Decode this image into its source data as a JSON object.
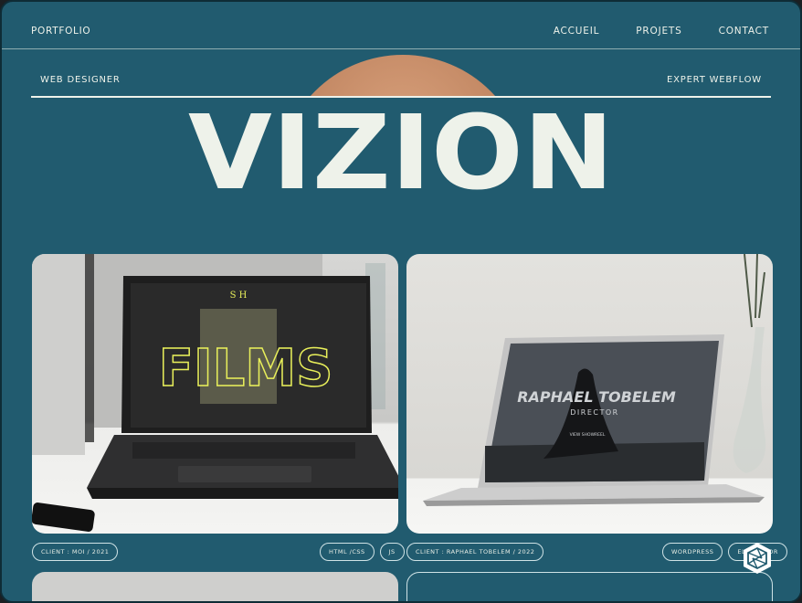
{
  "nav": {
    "brand": "PORTFOLIO",
    "links": [
      "ACCUEIL",
      "PROJETS",
      "CONTACT"
    ]
  },
  "header": {
    "left_label": "WEB DESIGNER",
    "right_label": "EXPERT WEBFLOW",
    "hero_title": "VIZION"
  },
  "projects": [
    {
      "client": "CLIENT : MOI / 2021",
      "tags": [
        "HTML /CSS",
        "JS"
      ],
      "screen_title": "FILMS",
      "screen_logo": "S H"
    },
    {
      "client": "CLIENT : RAPHAEL TOBELEM / 2022",
      "tags": [
        "WORDPRESS",
        "ELEMENTOR"
      ],
      "screen_title": "RAPHAEL TOBELEM",
      "screen_subtitle": "DIRECTOR",
      "screen_button": "VIEW SHOWREEL"
    }
  ],
  "colors": {
    "background": "#215b6f",
    "text": "#eef2ea",
    "sun": "#c88a64",
    "films_accent": "#e8ef5a"
  }
}
